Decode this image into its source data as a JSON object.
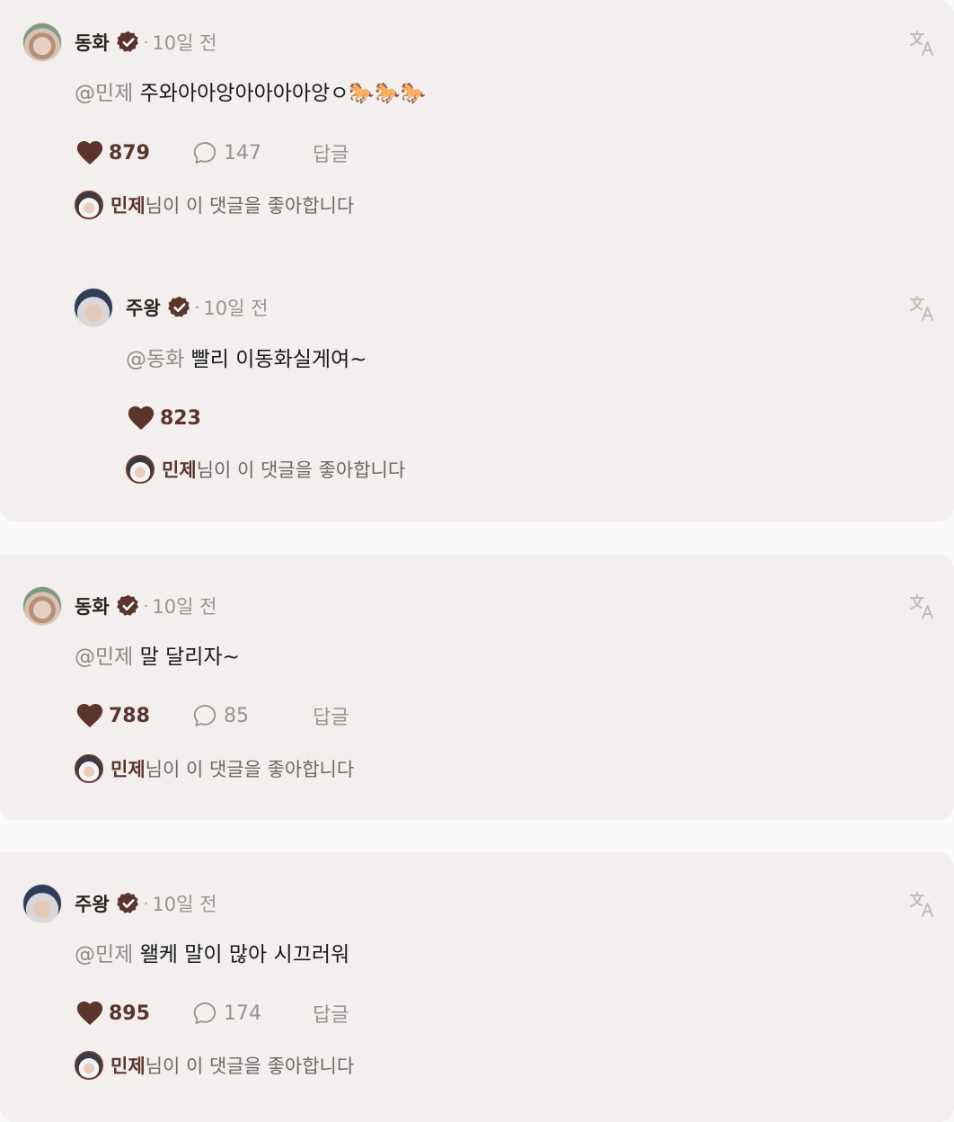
{
  "liked_by_text": "님이 이 댓글을 좋아합니다",
  "colors": {
    "card_bg": "#f2efee",
    "accent_brown": "#5b342c",
    "muted": "#9a9290"
  },
  "threads": [
    {
      "comment": {
        "author": "동화",
        "dot": "·",
        "time": "10일 전",
        "mention": "@민제",
        "text": " 주와아아앙아아아아앙ㅇ🐎🐎🐎",
        "likes": "879",
        "replies": "147",
        "reply_label": "답글",
        "liked_by": "민제"
      },
      "reply": {
        "author": "주왕",
        "dot": "·",
        "time": "10일 전",
        "mention": "@동화",
        "text": " 빨리 이동화실게여~",
        "likes": "823",
        "liked_by": "민제"
      }
    },
    {
      "comment": {
        "author": "동화",
        "dot": "·",
        "time": "10일 전",
        "mention": "@민제",
        "text": " 말 달리자~",
        "likes": "788",
        "replies": "85",
        "reply_label": "답글",
        "liked_by": "민제"
      }
    },
    {
      "comment": {
        "author": "주왕",
        "dot": "·",
        "time": "10일 전",
        "mention": "@민제",
        "text": " 왤케 말이 많아 시끄러워",
        "likes": "895",
        "replies": "174",
        "reply_label": "답글",
        "liked_by": "민제"
      }
    }
  ]
}
